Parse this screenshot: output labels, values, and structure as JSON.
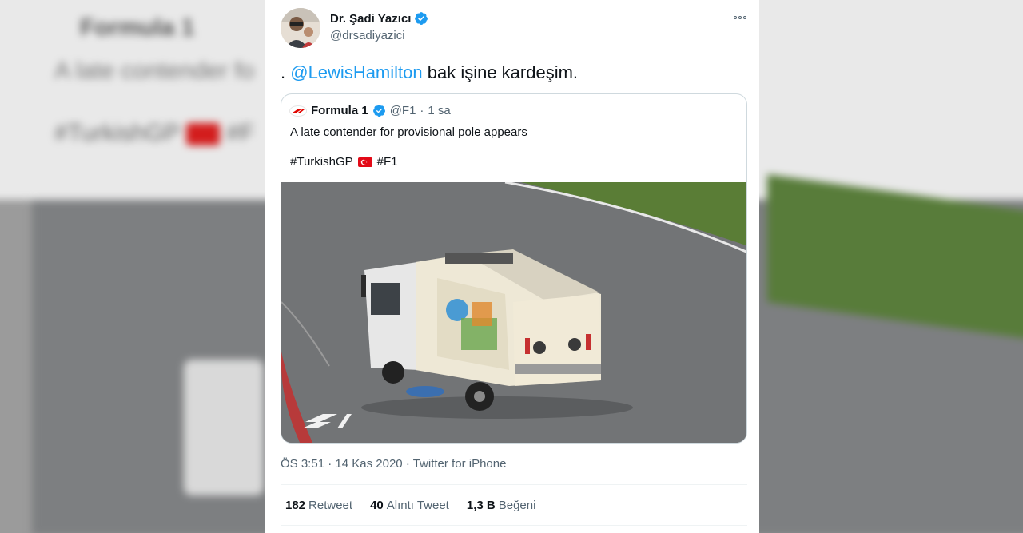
{
  "background": {
    "author": "Formula 1",
    "line2": "A late contender fo",
    "tags": "#TurkishGP",
    "tags2": "#F"
  },
  "tweet": {
    "author_name": "Dr. Şadi Yazıcı",
    "handle": "@drsadiyazici",
    "prefix": ". ",
    "mention": "@LewisHamilton",
    "text_rest": " bak işine kardeşim."
  },
  "quoted": {
    "author_name": "Formula 1",
    "handle": "@F1",
    "separator": "·",
    "time": "1 sa",
    "text": "A late contender for provisional pole appears",
    "hashtag1": "#TurkishGP",
    "hashtag2": "#F1"
  },
  "meta": {
    "time": "ÖS 3:51",
    "sep1": "·",
    "date": "14 Kas 2020",
    "sep2": "·",
    "source": "Twitter for iPhone"
  },
  "stats": [
    {
      "count": "182",
      "label": "Retweet"
    },
    {
      "count": "40",
      "label": "Alıntı Tweet"
    },
    {
      "count": "1,3 B",
      "label": "Beğeni"
    }
  ],
  "colors": {
    "accent": "#1d9bf0",
    "muted": "#536471",
    "text": "#0f1419",
    "border": "#cfd9de",
    "flag_red": "#e30a17"
  },
  "icons": {
    "verified": "verified-badge-icon",
    "more": "more-options-icon",
    "f1_logo": "f1-logo-icon",
    "flag": "turkey-flag-icon"
  }
}
